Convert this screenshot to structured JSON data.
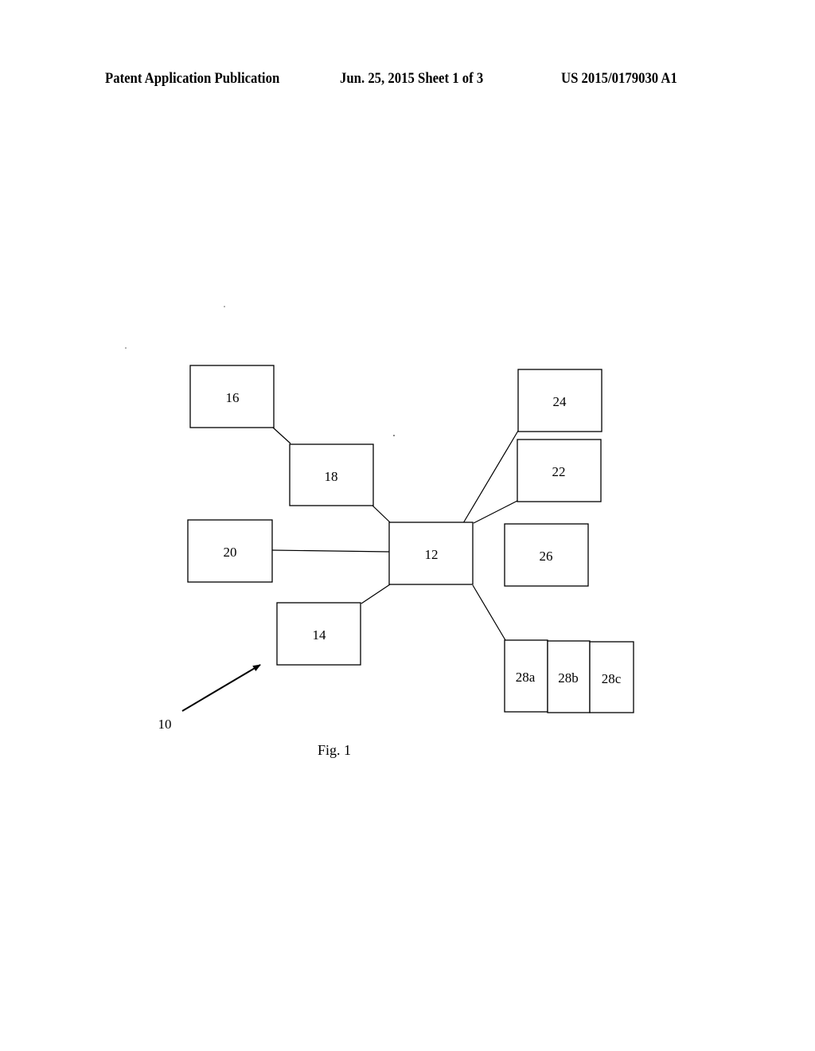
{
  "header": {
    "publication": "Patent Application Publication",
    "date_sheet": "Jun. 25, 2015  Sheet 1 of 3",
    "number": "US 2015/0179030 A1"
  },
  "figure": {
    "caption": "Fig. 1",
    "reference_label": "10",
    "blocks": {
      "b12": "12",
      "b14": "14",
      "b16": "16",
      "b18": "18",
      "b20": "20",
      "b22": "22",
      "b24": "24",
      "b26": "26",
      "b28a": "28a",
      "b28b": "28b",
      "b28c": "28c"
    },
    "connections": [
      [
        "16",
        "18"
      ],
      [
        "18",
        "12"
      ],
      [
        "20",
        "12"
      ],
      [
        "14",
        "12"
      ],
      [
        "24",
        "12"
      ],
      [
        "22",
        "12"
      ],
      [
        "12",
        "28a"
      ]
    ]
  }
}
